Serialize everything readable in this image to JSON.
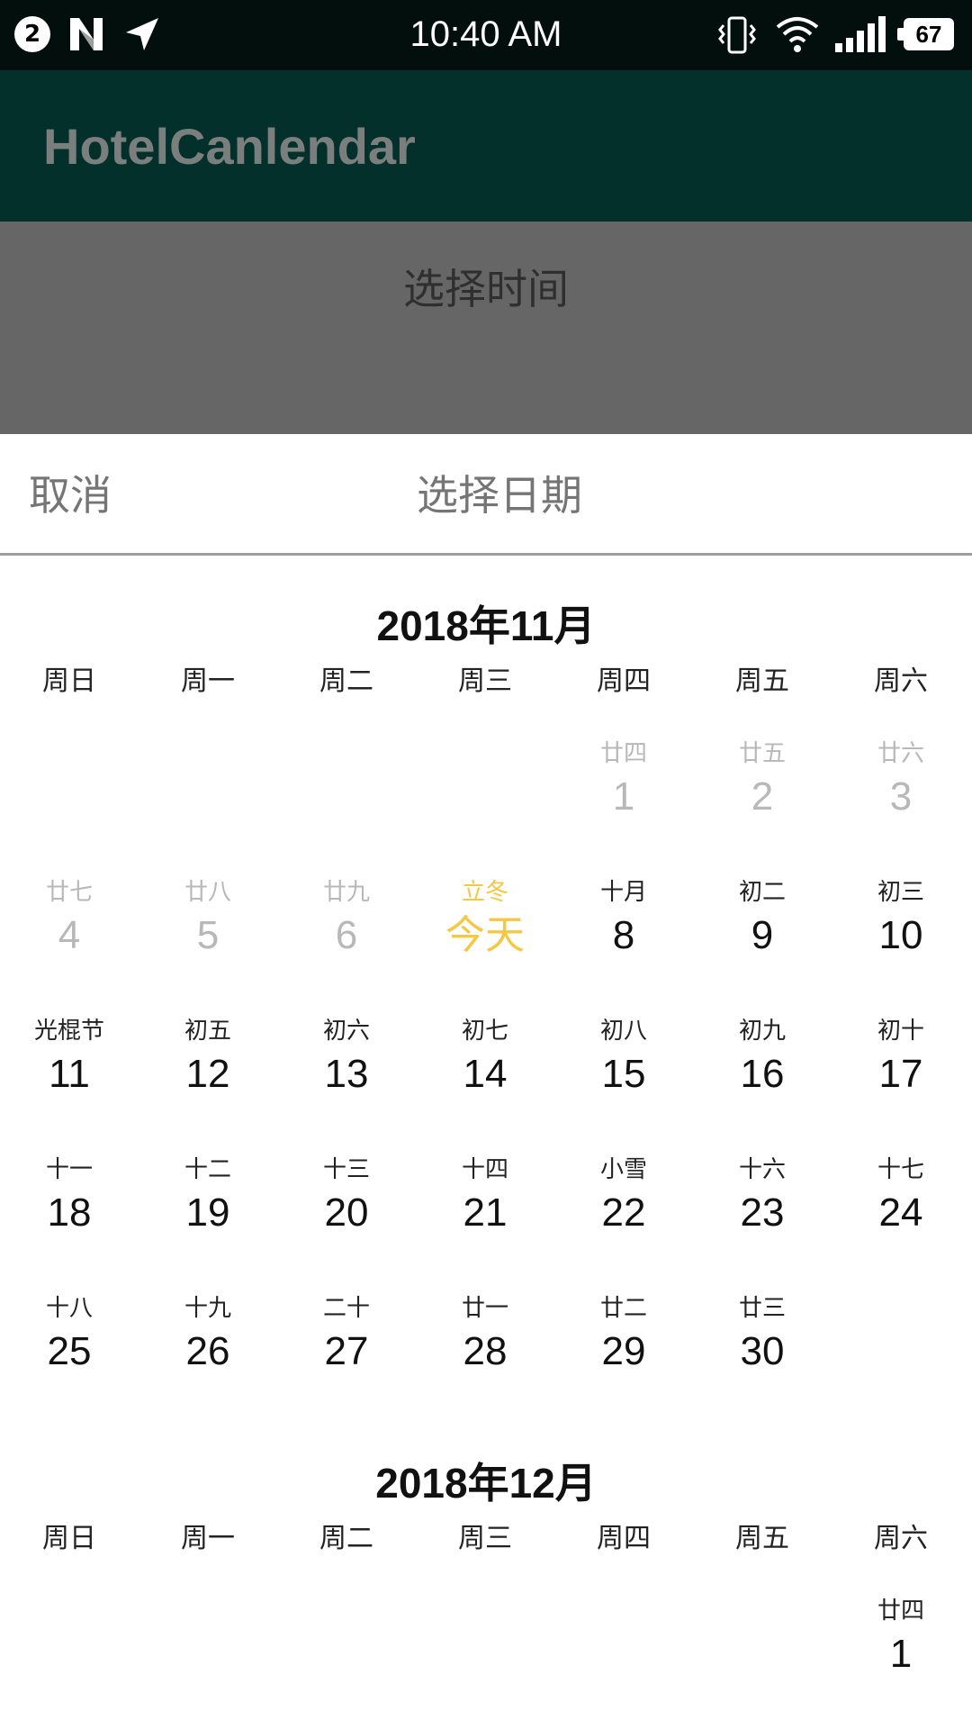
{
  "status_bar": {
    "notification_count": "2",
    "time": "10:40 AM",
    "battery": "67"
  },
  "app_bar": {
    "title": "HotelCanlendar"
  },
  "background": {
    "select_time_label": "选择时间"
  },
  "sheet": {
    "cancel_label": "取消",
    "title": "选择日期"
  },
  "weekdays": [
    "周日",
    "周一",
    "周二",
    "周三",
    "周四",
    "周五",
    "周六"
  ],
  "months": [
    {
      "title": "2018年11月",
      "leading_blank": 4,
      "days": [
        {
          "day": "1",
          "lunar": "廿四",
          "state": "past"
        },
        {
          "day": "2",
          "lunar": "廿五",
          "state": "past"
        },
        {
          "day": "3",
          "lunar": "廿六",
          "state": "past"
        },
        {
          "day": "4",
          "lunar": "廿七",
          "state": "past"
        },
        {
          "day": "5",
          "lunar": "廿八",
          "state": "past"
        },
        {
          "day": "6",
          "lunar": "廿九",
          "state": "past"
        },
        {
          "day": "今天",
          "lunar": "立冬",
          "state": "today"
        },
        {
          "day": "8",
          "lunar": "十月",
          "state": "normal"
        },
        {
          "day": "9",
          "lunar": "初二",
          "state": "normal"
        },
        {
          "day": "10",
          "lunar": "初三",
          "state": "normal"
        },
        {
          "day": "11",
          "lunar": "光棍节",
          "state": "normal"
        },
        {
          "day": "12",
          "lunar": "初五",
          "state": "normal"
        },
        {
          "day": "13",
          "lunar": "初六",
          "state": "normal"
        },
        {
          "day": "14",
          "lunar": "初七",
          "state": "normal"
        },
        {
          "day": "15",
          "lunar": "初八",
          "state": "normal"
        },
        {
          "day": "16",
          "lunar": "初九",
          "state": "normal"
        },
        {
          "day": "17",
          "lunar": "初十",
          "state": "normal"
        },
        {
          "day": "18",
          "lunar": "十一",
          "state": "normal"
        },
        {
          "day": "19",
          "lunar": "十二",
          "state": "normal"
        },
        {
          "day": "20",
          "lunar": "十三",
          "state": "normal"
        },
        {
          "day": "21",
          "lunar": "十四",
          "state": "normal"
        },
        {
          "day": "22",
          "lunar": "小雪",
          "state": "normal"
        },
        {
          "day": "23",
          "lunar": "十六",
          "state": "normal"
        },
        {
          "day": "24",
          "lunar": "十七",
          "state": "normal"
        },
        {
          "day": "25",
          "lunar": "十八",
          "state": "normal"
        },
        {
          "day": "26",
          "lunar": "十九",
          "state": "normal"
        },
        {
          "day": "27",
          "lunar": "二十",
          "state": "normal"
        },
        {
          "day": "28",
          "lunar": "廿一",
          "state": "normal"
        },
        {
          "day": "29",
          "lunar": "廿二",
          "state": "normal"
        },
        {
          "day": "30",
          "lunar": "廿三",
          "state": "normal"
        }
      ]
    },
    {
      "title": "2018年12月",
      "leading_blank": 6,
      "days": [
        {
          "day": "1",
          "lunar": "廿四",
          "state": "normal"
        }
      ]
    }
  ]
}
